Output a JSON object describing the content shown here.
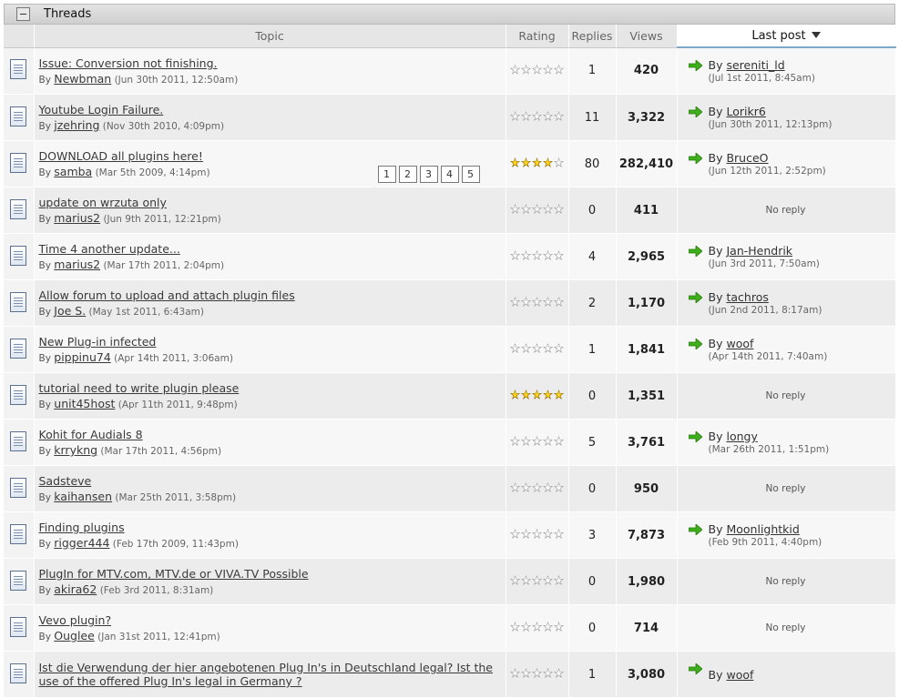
{
  "panel": {
    "title": "Threads"
  },
  "columns": {
    "topic": "Topic",
    "rating": "Rating",
    "replies": "Replies",
    "views": "Views",
    "last_post": "Last post"
  },
  "colors": {
    "row_alt": "#f7f7f7",
    "row_main": "#ececec",
    "star_on": "#ffd21c",
    "arrow": "#3fae1b"
  },
  "threads": [
    {
      "title": "Issue: Conversion not finishing.",
      "by": "By",
      "author": "Newbman",
      "date": "(Jun 30th 2011, 12:50am)",
      "rating": 0,
      "replies": "1",
      "views": "420",
      "last_by": "By",
      "last_author": "sereniti_ld",
      "last_date": "(Jul 1st 2011, 8:45am)"
    },
    {
      "title": "Youtube Login Failure.",
      "by": "By",
      "author": "jzehring",
      "date": "(Nov 30th 2010, 4:09pm)",
      "rating": 0,
      "replies": "11",
      "views": "3,322",
      "last_by": "By",
      "last_author": "Lorikr6",
      "last_date": "(Jun 30th 2011, 12:13pm)"
    },
    {
      "title": "DOWNLOAD all plugins here!",
      "by": "By",
      "author": "samba",
      "date": "(Mar 5th 2009, 4:14pm)",
      "rating": 4,
      "replies": "80",
      "views": "282,410",
      "last_by": "By",
      "last_author": "BruceO",
      "last_date": "(Jun 12th 2011, 2:52pm)",
      "pages": [
        "1",
        "2",
        "3",
        "4",
        "5"
      ]
    },
    {
      "title": "update on wrzuta only",
      "by": "By",
      "author": "marius2",
      "date": "(Jun 9th 2011, 12:21pm)",
      "rating": 0,
      "replies": "0",
      "views": "411",
      "no_reply": "No reply"
    },
    {
      "title": "Time 4 another update...",
      "by": "By",
      "author": "marius2",
      "date": "(Mar 17th 2011, 2:04pm)",
      "rating": 0,
      "replies": "4",
      "views": "2,965",
      "last_by": "By",
      "last_author": "Jan-Hendrik",
      "last_date": "(Jun 3rd 2011, 7:50am)"
    },
    {
      "title": "Allow forum to upload and attach plugin files",
      "by": "By",
      "author": "Joe S.",
      "date": "(May 1st 2011, 6:43am)",
      "rating": 0,
      "replies": "2",
      "views": "1,170",
      "last_by": "By",
      "last_author": "tachros",
      "last_date": "(Jun 2nd 2011, 8:17am)"
    },
    {
      "title": "New Plug-in infected",
      "by": "By",
      "author": "pippinu74",
      "date": "(Apr 14th 2011, 3:06am)",
      "rating": 0,
      "replies": "1",
      "views": "1,841",
      "last_by": "By",
      "last_author": "woof",
      "last_date": "(Apr 14th 2011, 7:40am)"
    },
    {
      "title": "tutorial need to write plugin please",
      "by": "By",
      "author": "unit45host",
      "date": "(Apr 11th 2011, 9:48pm)",
      "rating": 5,
      "replies": "0",
      "views": "1,351",
      "no_reply": "No reply"
    },
    {
      "title": "Kohit for Audials 8",
      "by": "By",
      "author": "krrykng",
      "date": "(Mar 17th 2011, 4:56pm)",
      "rating": 0,
      "replies": "5",
      "views": "3,761",
      "last_by": "By",
      "last_author": "longy",
      "last_date": "(Mar 26th 2011, 1:51pm)"
    },
    {
      "title": "Sadsteve",
      "by": "By",
      "author": "kaihansen",
      "date": "(Mar 25th 2011, 3:58pm)",
      "rating": 0,
      "replies": "0",
      "views": "950",
      "no_reply": "No reply"
    },
    {
      "title": "Finding plugins",
      "by": "By",
      "author": "rigger444",
      "date": "(Feb 17th 2009, 11:43pm)",
      "rating": 0,
      "replies": "3",
      "views": "7,873",
      "last_by": "By",
      "last_author": "Moonlightkid",
      "last_date": "(Feb 9th 2011, 4:40pm)"
    },
    {
      "title": "PlugIn for MTV.com, MTV.de or VIVA.TV Possible",
      "by": "By",
      "author": "akira62",
      "date": "(Feb 3rd 2011, 8:31am)",
      "rating": 0,
      "replies": "0",
      "views": "1,980",
      "no_reply": "No reply"
    },
    {
      "title": "Vevo plugin?",
      "by": "By",
      "author": "Ouglee",
      "date": "(Jan 31st 2011, 12:41pm)",
      "rating": 0,
      "replies": "0",
      "views": "714",
      "no_reply": "No reply"
    },
    {
      "title": "Ist die Verwendung der hier angebotenen Plug In's in Deutschland legal? Ist the use of the offered Plug In's legal in Germany ?",
      "by": "",
      "author": "",
      "date": "",
      "rating": 0,
      "replies": "1",
      "views": "3,080",
      "last_by": "By",
      "last_author": "woof",
      "last_date": ""
    }
  ]
}
